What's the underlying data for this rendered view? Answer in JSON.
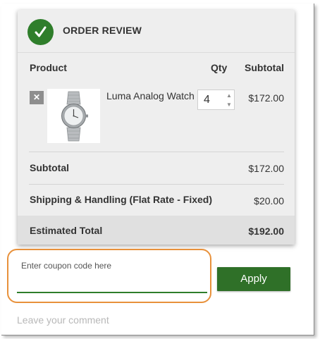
{
  "order_review": {
    "title": "ORDER REVIEW",
    "columns": {
      "product": "Product",
      "qty": "Qty",
      "subtotal": "Subtotal"
    },
    "items": [
      {
        "remove_glyph": "✕",
        "name": "Luma Analog Watch",
        "qty": "4",
        "subtotal": "$172.00",
        "image_icon": "wristwatch-icon"
      }
    ],
    "totals": {
      "subtotal_label": "Subtotal",
      "subtotal_value": "$172.00",
      "shipping_label": "Shipping & Handling (Flat Rate - Fixed)",
      "shipping_value": "$20.00",
      "total_label": "Estimated Total",
      "total_value": "$192.00"
    }
  },
  "coupon": {
    "placeholder": "Enter coupon code here",
    "apply_label": "Apply"
  },
  "comment": {
    "placeholder": "Leave your comment"
  },
  "colors": {
    "accent_green": "#2f7e2b",
    "highlight_orange": "#e8913b",
    "panel_bg": "#eeeeee"
  }
}
